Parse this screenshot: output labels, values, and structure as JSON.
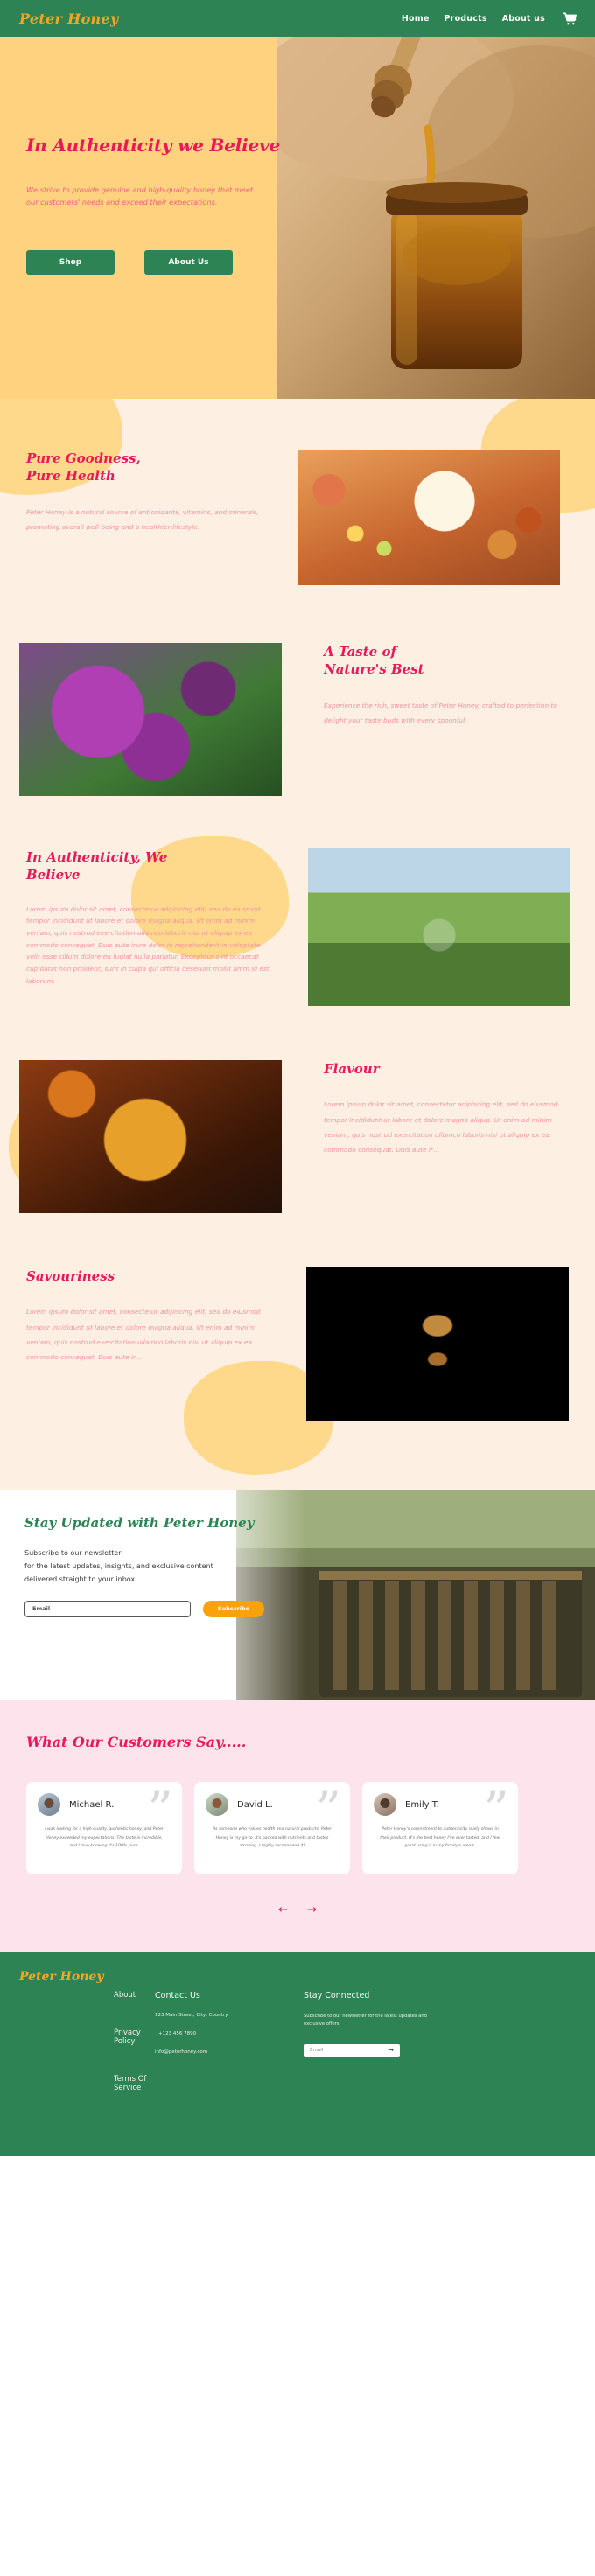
{
  "header": {
    "logo": "Peter Honey",
    "nav": [
      {
        "label": "Home"
      },
      {
        "label": "Products"
      },
      {
        "label": "About us"
      }
    ],
    "cart_icon": "shopping-cart-icon"
  },
  "hero": {
    "title": "In Authenticity we Believe",
    "subtitle": "We strive to provide genuine and high-quality honey that meet our customers' needs and exceed their expectations.",
    "primary_button": "Shop",
    "secondary_button": "About Us"
  },
  "features": [
    {
      "title": "Pure Goodness,\nPure Health",
      "body": "Peter Honey is a natural source of antioxidants, vitamins, and minerals, promoting overall well-being and a healthier lifestyle.",
      "image": "cheese-board-with-honey-photo"
    },
    {
      "title": "A Taste of\nNature's Best",
      "body": "Experience the rich, sweet taste of Peter Honey, crafted to perfection to delight your taste buds with every spoonful.",
      "image": "bee-on-purple-hyacinth-photo"
    },
    {
      "title": "In Authenticity, We\nBelieve",
      "body": "Lorem ipsum dolor sit amet, consectetur adipiscing elit, sed do eiusmod tempor incididunt ut labore et dolore magna aliqua. Ut enim ad minim veniam, quis nostrud exercitation ullamco laboris nisi ut aliquip ex ea commodo consequat. Duis aute irure dolor in reprehenderit in voluptate velit esse cillum dolore eu fugiat nulla pariatur. Excepteur sint occaecat cupidatat non proident, sunt in culpa qui officia deserunt mollit anim id est laborum.",
      "image": "beekeeper-in-meadow-photo"
    },
    {
      "title": "Flavour",
      "body": "Lorem ipsum dolor sit amet, consectetur adipiscing elit, sed do eiusmod tempor incididunt ut labore et dolore magna aliqua. Ut enim ad minim veniam, quis nostrud exercitation ullamco laboris nisi ut aliquip ex ea commodo consequat. Duis aute ir…",
      "image": "honey-jar-with-dipper-photo"
    },
    {
      "title": "Savouriness",
      "body": "Lorem ipsum dolor sit amet, consectetur adipiscing elit, sed do eiusmod tempor incididunt ut labore et dolore magna aliqua. Ut enim ad minim veniam, quis nostrud exercitation ullamco laboris nisi ut aliquip ex ea commodo consequat. Duis aute ir…",
      "image": "honey-dipper-on-black-photo"
    }
  ],
  "newsletter": {
    "title": "Stay Updated with Peter  Honey",
    "subtitle": "Subscribe to our newsletter\nfor the latest updates, insights, and exclusive content\ndelivered straight to your inbox.",
    "input_placeholder": "Email",
    "input_value": "",
    "button": "Subscribe",
    "image": "beehive-frames-photo"
  },
  "testimonials": {
    "title": "What Our Customers Say.....",
    "cards": [
      {
        "name": "Michael R.",
        "text": "I was looking for a high-quality, authentic honey, and Peter Honey exceeded my expectations. The taste is incredible, and I love knowing it's 100% pure.",
        "avatar": "avatar-michael"
      },
      {
        "name": "David L.",
        "text": "As someone who values health and natural products, Peter Honey is my go-to. It's packed with nutrients and tastes amazing. I highly recommend it!",
        "avatar": "avatar-david"
      },
      {
        "name": "Emily T.",
        "text": "Peter Honey's commitment to authenticity really shows in their product. It's the best honey I've ever tasted, and I feel great using it in my family's meals.",
        "avatar": "avatar-emily"
      }
    ],
    "prev_arrow": "←",
    "next_arrow": "→"
  },
  "footer": {
    "logo": "Peter Honey",
    "links": [
      {
        "label": "About"
      },
      {
        "label": "Privacy Policy"
      },
      {
        "label": "Terms Of Service"
      }
    ],
    "contact": {
      "heading": "Contact Us",
      "address": "123 Main Street, City, Country",
      "phone": "+123 456 7890",
      "email": "info@peterhoney.com"
    },
    "social": {
      "heading": "Stay Connected",
      "subtitle": "Subscribe to our newsletter for the latest updates and exclusive offers.",
      "input_placeholder": "Email",
      "input_value": "",
      "submit_icon": "arrow-right-icon"
    }
  },
  "colors": {
    "green": "#2e8355",
    "orange": "#f5a623",
    "pink": "#e8185a",
    "light_pink": "#f7909f",
    "cream": "#fdf0e2",
    "hero_yellow": "#ffd27f",
    "blob_yellow": "#ffd98b",
    "testimonial_bg": "#fde4ec"
  }
}
